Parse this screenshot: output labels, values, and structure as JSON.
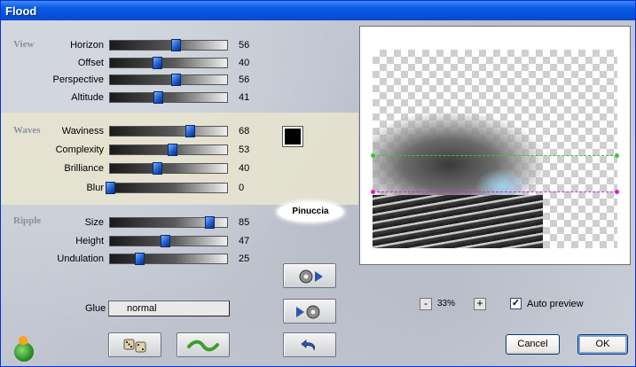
{
  "window": {
    "title": "Flood"
  },
  "sections": {
    "view": "View",
    "waves": "Waves",
    "ripple": "Ripple"
  },
  "sliders": {
    "horizon": {
      "label": "Horizon",
      "value": "56",
      "fraction": 0.56
    },
    "offset": {
      "label": "Offset",
      "value": "40",
      "fraction": 0.4
    },
    "perspective": {
      "label": "Perspective",
      "value": "56",
      "fraction": 0.56
    },
    "altitude": {
      "label": "Altitude",
      "value": "41",
      "fraction": 0.41
    },
    "waviness": {
      "label": "Waviness",
      "value": "68",
      "fraction": 0.68
    },
    "complexity": {
      "label": "Complexity",
      "value": "53",
      "fraction": 0.53
    },
    "brilliance": {
      "label": "Brilliance",
      "value": "40",
      "fraction": 0.4
    },
    "blur": {
      "label": "Blur",
      "value": "0",
      "fraction": 0.0
    },
    "size": {
      "label": "Size",
      "value": "85",
      "fraction": 0.85
    },
    "height": {
      "label": "Height",
      "value": "47",
      "fraction": 0.47
    },
    "undulation": {
      "label": "Undulation",
      "value": "25",
      "fraction": 0.25
    }
  },
  "waves_color": "#000000",
  "watermark": "Pinuccia",
  "glue": {
    "label": "Glue",
    "value": "normal"
  },
  "icons": {
    "random": "dice-icon",
    "reset": "wave-icon",
    "play_forward": "film-reel-forward-icon",
    "play_back": "film-reel-back-icon",
    "undo": "undo-arrow-icon",
    "app": "app-logo-icon"
  },
  "preview": {
    "zoom": "33%",
    "zoom_minus": "-",
    "zoom_plus": "+",
    "auto_preview_label": "Auto preview",
    "auto_preview_checked": true,
    "check_mark": "✓"
  },
  "buttons": {
    "cancel": "Cancel",
    "ok": "OK"
  },
  "colors": {
    "title_bar": "#0a5ee6",
    "guide_top": "#3bc43b",
    "guide_bottom": "#d81ed8"
  }
}
